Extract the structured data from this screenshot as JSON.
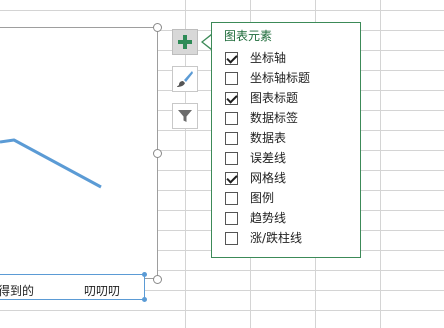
{
  "chart": {
    "axis_labels": [
      "得到的",
      "叨叨叨"
    ]
  },
  "side_buttons": {
    "elements_icon": "plus-icon",
    "styles_icon": "paintbrush-icon",
    "filters_icon": "funnel-icon"
  },
  "elements_panel": {
    "title": "图表元素",
    "items": [
      {
        "label": "坐标轴",
        "checked": true
      },
      {
        "label": "坐标轴标题",
        "checked": false
      },
      {
        "label": "图表标题",
        "checked": true
      },
      {
        "label": "数据标签",
        "checked": false
      },
      {
        "label": "数据表",
        "checked": false
      },
      {
        "label": "误差线",
        "checked": false
      },
      {
        "label": "网格线",
        "checked": true
      },
      {
        "label": "图例",
        "checked": false
      },
      {
        "label": "趋势线",
        "checked": false
      },
      {
        "label": "涨/跌柱线",
        "checked": false
      }
    ]
  },
  "colors": {
    "series_line": "#5b9bd5",
    "panel_border": "#3c8a58",
    "panel_title": "#1e6b3a",
    "plus_icon": "#2e8b57"
  }
}
